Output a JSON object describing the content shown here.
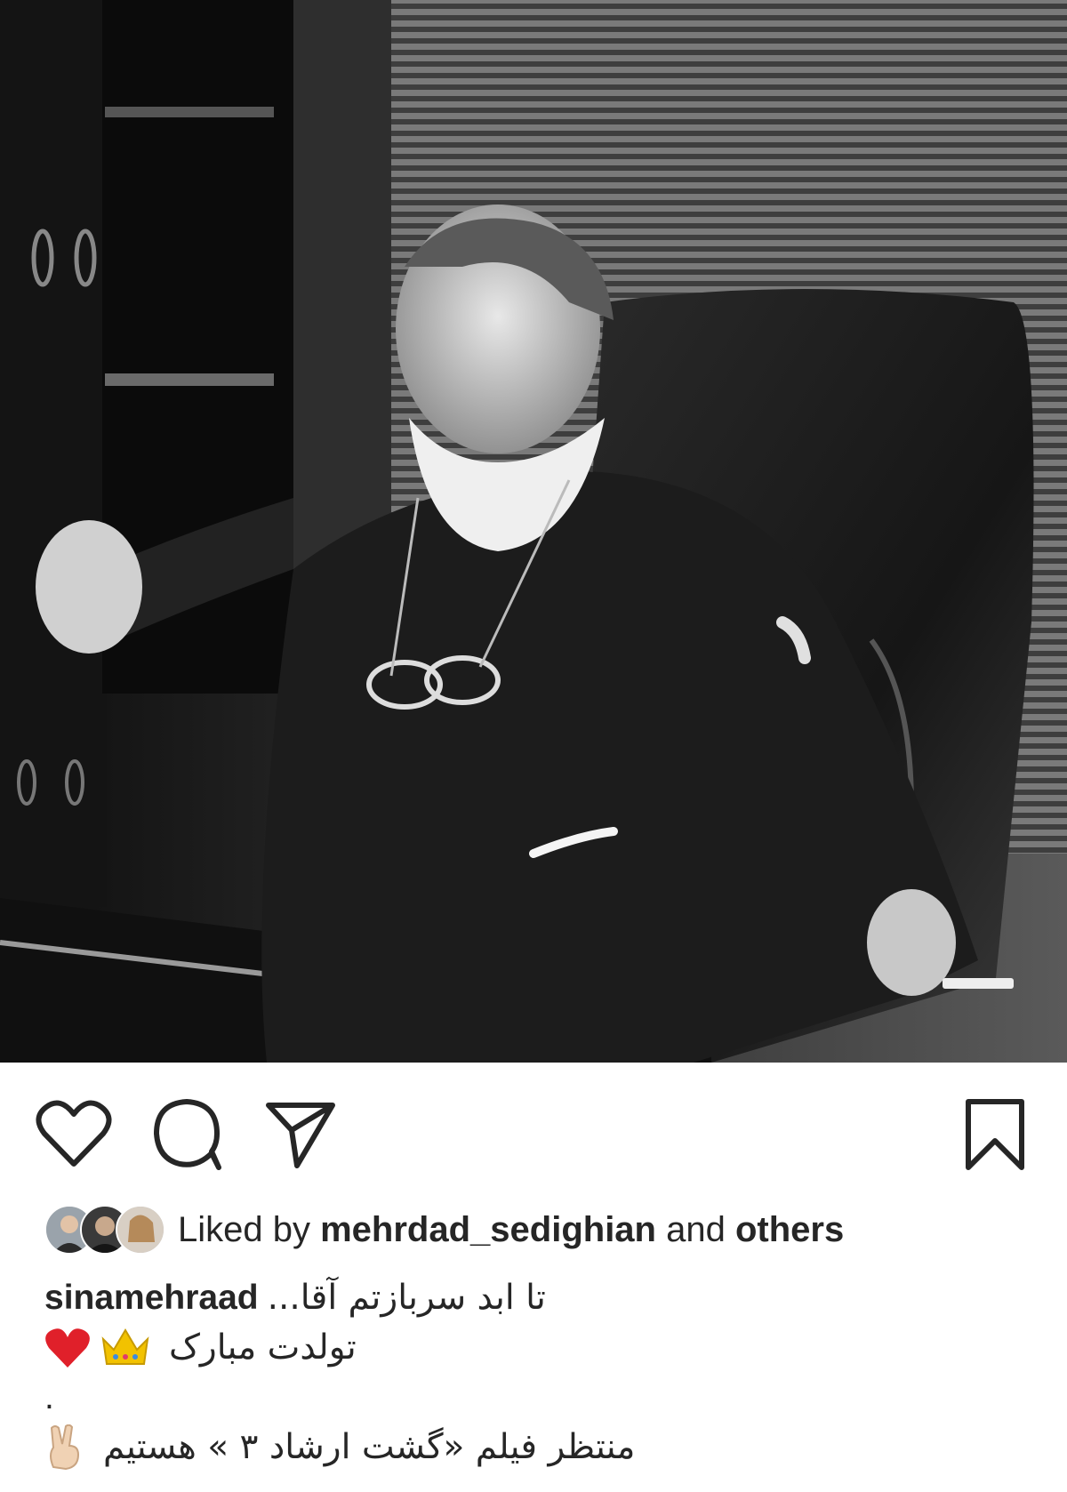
{
  "post": {
    "image": {
      "description_icon": "photo-of-man-in-office-chair"
    },
    "actions": {
      "like_icon": "heart-icon",
      "comment_icon": "comment-bubble-icon",
      "share_icon": "paper-plane-icon",
      "save_icon": "bookmark-icon"
    },
    "likes": {
      "prefix": "Liked by",
      "user": "mehrdad_sedighian",
      "connector": "and",
      "others": "others"
    },
    "caption": {
      "username": "sinamehraad",
      "line1": "تا ابد سربازتم آقا...",
      "line2": "تولدت مبارک",
      "line3": ".",
      "line4": "منتظر فیلم «گشت ارشاد ۳ » هستیم"
    }
  },
  "colors": {
    "text": "#262626",
    "heart_emoji": "#e0202a",
    "crown_emoji": "#f2c200"
  }
}
